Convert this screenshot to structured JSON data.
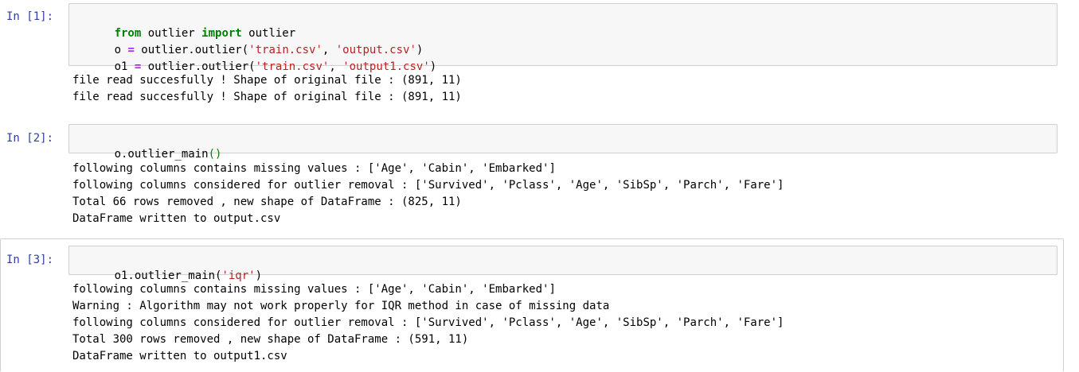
{
  "cells": [
    {
      "prompt": "In [1]:",
      "code": [
        [
          {
            "t": "from",
            "c": "kw"
          },
          {
            "t": " outlier ",
            "c": ""
          },
          {
            "t": "import",
            "c": "kw"
          },
          {
            "t": " outlier",
            "c": ""
          }
        ],
        [
          {
            "t": "o ",
            "c": ""
          },
          {
            "t": "=",
            "c": "op"
          },
          {
            "t": " outlier.outlier(",
            "c": ""
          },
          {
            "t": "'train.csv'",
            "c": "str"
          },
          {
            "t": ", ",
            "c": ""
          },
          {
            "t": "'output.csv'",
            "c": "str"
          },
          {
            "t": ")",
            "c": ""
          }
        ],
        [
          {
            "t": "o1 ",
            "c": ""
          },
          {
            "t": "=",
            "c": "op"
          },
          {
            "t": " outlier.outlier(",
            "c": ""
          },
          {
            "t": "'train.csv'",
            "c": "str"
          },
          {
            "t": ", ",
            "c": ""
          },
          {
            "t": "'output1.csv'",
            "c": "str"
          },
          {
            "t": ")",
            "c": ""
          }
        ]
      ],
      "output": [
        "file read succesfully ! Shape of original file : (891, 11)",
        "file read succesfully ! Shape of original file : (891, 11)"
      ]
    },
    {
      "prompt": "In [2]:",
      "code": [
        [
          {
            "t": "o.outlier_main",
            "c": ""
          },
          {
            "t": "()",
            "c": "paren"
          }
        ]
      ],
      "output": [
        "following columns contains missing values : ['Age', 'Cabin', 'Embarked']",
        "following columns considered for outlier removal : ['Survived', 'Pclass', 'Age', 'SibSp', 'Parch', 'Fare']",
        "Total 66 rows removed , new shape of DataFrame : (825, 11)",
        "DataFrame written to output.csv"
      ]
    },
    {
      "prompt": "In [3]:",
      "code": [
        [
          {
            "t": "o1.outlier_main(",
            "c": ""
          },
          {
            "t": "'iqr'",
            "c": "str"
          },
          {
            "t": ")",
            "c": ""
          }
        ]
      ],
      "output": [
        "following columns contains missing values : ['Age', 'Cabin', 'Embarked']",
        "Warning : Algorithm may not work properly for IQR method in case of missing data",
        "following columns considered for outlier removal : ['Survived', 'Pclass', 'Age', 'SibSp', 'Parch', 'Fare']",
        "Total 300 rows removed , new shape of DataFrame : (591, 11)",
        "DataFrame written to output1.csv"
      ]
    }
  ]
}
